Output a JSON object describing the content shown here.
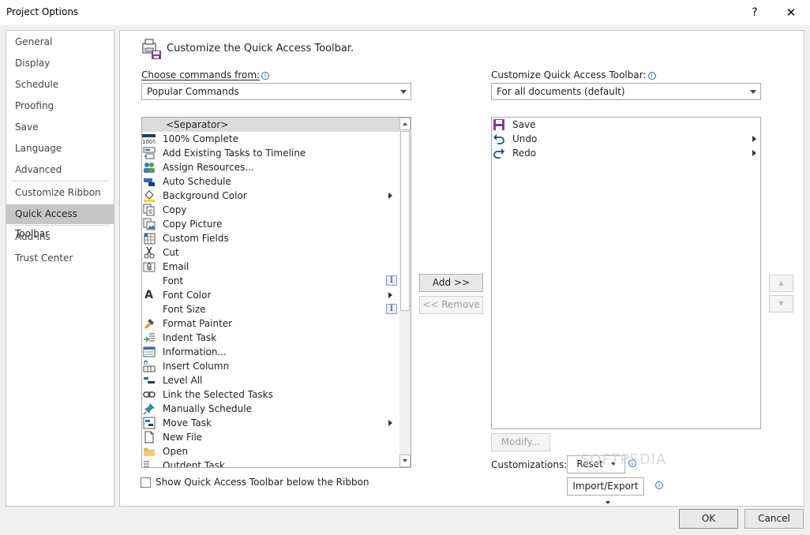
{
  "window": {
    "title": "Project Options",
    "help_glyph": "?",
    "close_glyph": "✕"
  },
  "nav": {
    "items": [
      {
        "label": "General"
      },
      {
        "label": "Display"
      },
      {
        "label": "Schedule"
      },
      {
        "label": "Proofing"
      },
      {
        "label": "Save"
      },
      {
        "label": "Language"
      },
      {
        "label": "Advanced"
      },
      {
        "label": "Customize Ribbon"
      },
      {
        "label": "Quick Access Toolbar"
      },
      {
        "label": "Add-ins"
      },
      {
        "label": "Trust Center"
      }
    ],
    "active_index": 8
  },
  "header": {
    "text": "Customize the Quick Access Toolbar."
  },
  "left": {
    "choose_label": "Choose commands from:",
    "choose_value": "Popular Commands",
    "commands": [
      {
        "label": "<Separator>",
        "icon": "separator"
      },
      {
        "label": "100% Complete",
        "icon": "percent-complete-icon"
      },
      {
        "label": "Add Existing Tasks to Timeline",
        "icon": "timeline-icon"
      },
      {
        "label": "Assign Resources...",
        "icon": "people-icon"
      },
      {
        "label": "Auto Schedule",
        "icon": "auto-schedule-icon"
      },
      {
        "label": "Background Color",
        "icon": "paint-bucket-icon"
      },
      {
        "label": "Copy",
        "icon": "copy-icon"
      },
      {
        "label": "Copy Picture",
        "icon": "copy-picture-icon"
      },
      {
        "label": "Custom Fields",
        "icon": "custom-fields-icon"
      },
      {
        "label": "Cut",
        "icon": "scissors-icon"
      },
      {
        "label": "Email",
        "icon": "paperclip-icon"
      },
      {
        "label": "Font",
        "icon": ""
      },
      {
        "label": "Font Color",
        "icon": "font-color-icon"
      },
      {
        "label": "Font Size",
        "icon": ""
      },
      {
        "label": "Format Painter",
        "icon": "paintbrush-icon"
      },
      {
        "label": "Indent Task",
        "icon": "indent-icon"
      },
      {
        "label": "Information...",
        "icon": "information-icon"
      },
      {
        "label": "Insert Column",
        "icon": "insert-column-icon"
      },
      {
        "label": "Level All",
        "icon": "level-all-icon"
      },
      {
        "label": "Link the Selected Tasks",
        "icon": "link-icon"
      },
      {
        "label": "Manually Schedule",
        "icon": "pushpin-icon"
      },
      {
        "label": "Move Task",
        "icon": "move-task-icon"
      },
      {
        "label": "New File",
        "icon": "new-file-icon"
      },
      {
        "label": "Open",
        "icon": "folder-icon"
      },
      {
        "label": "Outdent Task",
        "icon": "outdent-icon"
      }
    ],
    "show_below_label": "Show Quick Access Toolbar below the Ribbon",
    "font_icon_glyph": "I"
  },
  "middle": {
    "add_label": "Add >>",
    "remove_label": "<< Remove"
  },
  "right": {
    "customize_label": "Customize Quick Access Toolbar:",
    "customize_value": "For all documents (default)",
    "toolbar_items": [
      {
        "label": "Save",
        "icon": "save-icon"
      },
      {
        "label": "Undo",
        "icon": "undo-icon"
      },
      {
        "label": "Redo",
        "icon": "redo-icon"
      }
    ],
    "modify_label": "Modify...",
    "customizations_label": "Customizations:",
    "reset_label": "Reset",
    "import_export_label": "Import/Export",
    "move_up_glyph": "▲",
    "move_down_glyph": "▼"
  },
  "footer": {
    "ok_label": "OK",
    "cancel_label": "Cancel"
  },
  "watermark": "SOFTPEDIA"
}
